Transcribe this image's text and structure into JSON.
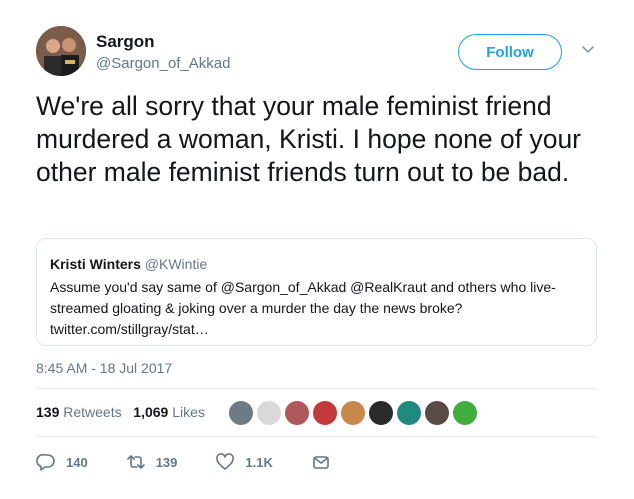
{
  "author": {
    "name": "Sargon",
    "handle": "@Sargon_of_Akkad",
    "follow_label": "Follow"
  },
  "tweet": {
    "text": "We're all sorry that your male feminist friend murdered a woman, Kristi. I hope none of your other male feminist friends turn out to be bad.",
    "timestamp": "8:45 AM - 18 Jul 2017"
  },
  "quoted": {
    "name": "Kristi Winters",
    "handle": "@KWintie",
    "text": "Assume you'd say same of @Sargon_of_Akkad @RealKraut and others who live-streamed gloating & joking over a murder the day the news broke? twitter.com/stillgray/stat…"
  },
  "stats": {
    "retweets_count": "139",
    "retweets_label": "Retweets",
    "likes_count": "1,069",
    "likes_label": "Likes"
  },
  "likers": [
    {
      "icon": "avatar-1",
      "color": "#6d7b84"
    },
    {
      "icon": "avatar-2",
      "color": "#d9d9d9"
    },
    {
      "icon": "avatar-3",
      "color": "#b0575a"
    },
    {
      "icon": "avatar-4",
      "color": "#c23a3a"
    },
    {
      "icon": "avatar-5",
      "color": "#c8884c"
    },
    {
      "icon": "avatar-6",
      "color": "#2b2b2b"
    },
    {
      "icon": "avatar-7",
      "color": "#1f8a80"
    },
    {
      "icon": "avatar-8",
      "color": "#5a4a47"
    },
    {
      "icon": "avatar-9",
      "color": "#3fae3f"
    }
  ],
  "actions": {
    "replies": "140",
    "retweets": "139",
    "likes": "1.1K"
  },
  "colors": {
    "accent": "#1da1f2",
    "secondary_text": "#657786",
    "border": "#e1e8ed"
  }
}
